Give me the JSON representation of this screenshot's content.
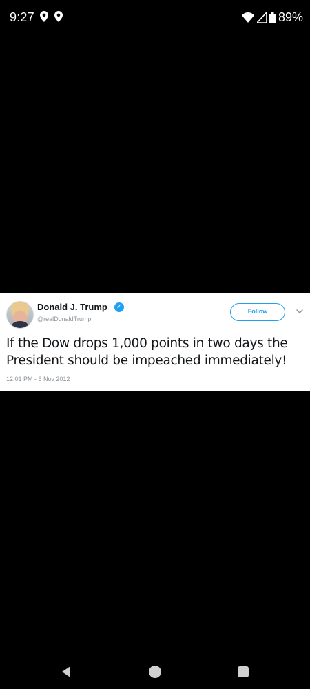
{
  "status_bar": {
    "time": "9:27",
    "battery": "89%",
    "left_icons": [
      "location-pin-icon",
      "location-pin-icon"
    ],
    "right_icons": [
      "wifi-icon",
      "cell-signal-icon",
      "battery-icon"
    ]
  },
  "tweet": {
    "display_name": "Donald J. Trump",
    "handle": "@realDonaldTrump",
    "follow_label": "Follow",
    "text": "If the Dow drops 1,000 points in two days the President should be impeached immediately!",
    "timestamp": "12:01 PM - 6 Nov 2012",
    "accent_color": "#1da1f2"
  },
  "nav_bar": {
    "buttons": [
      "back-icon",
      "home-icon",
      "recents-icon"
    ]
  }
}
